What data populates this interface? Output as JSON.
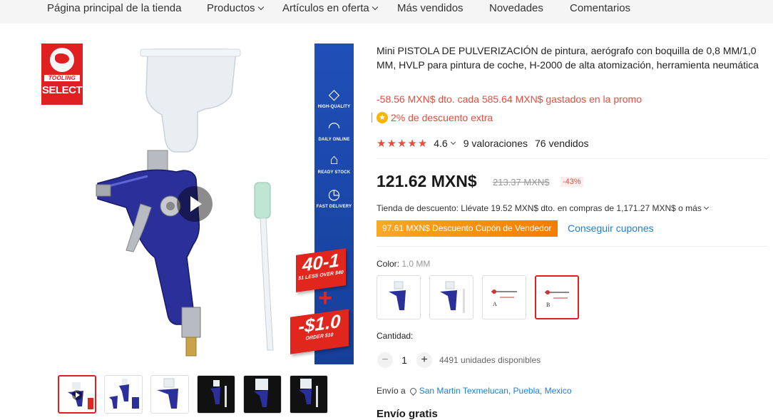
{
  "nav": {
    "items": [
      {
        "label": "Página principal de la tienda",
        "dropdown": false
      },
      {
        "label": "Productos",
        "dropdown": true
      },
      {
        "label": "Artículos en oferta",
        "dropdown": true
      },
      {
        "label": "Más vendidos",
        "dropdown": false
      },
      {
        "label": "Novedades",
        "dropdown": false
      },
      {
        "label": "Comentarios",
        "dropdown": false
      }
    ]
  },
  "gallery": {
    "brand_badge": {
      "line1": "TOOLING",
      "line2": "SELECT"
    },
    "features": [
      {
        "icon": "diamond-icon",
        "label": "HIGH-QUALITY"
      },
      {
        "icon": "headset-icon",
        "label": "DAILY ONLINE"
      },
      {
        "icon": "warehouse-icon",
        "label": "READY STOCK"
      },
      {
        "icon": "clock-icon",
        "label": "FAST DELIVERY"
      }
    ],
    "promo": {
      "big1": "40-1",
      "small1": "$1 LESS OVER $40",
      "plus": "+",
      "big2": "-$1.0",
      "small2": "ORDER $10"
    },
    "thumbnails": 6,
    "active_thumbnail": 0
  },
  "product": {
    "title": "Mini PISTOLA DE PULVERIZACIÓN de pintura, aerógrafo con boquilla de 0,8 MM/1,0 MM, HVLP para pintura de coche, H-2000 de alta atomización, herramienta neumática",
    "promo_text": "-58.56 MXN$ dto. cada 585.64 MXN$ gastados en la promo",
    "extra_discount": "2% de descuento extra",
    "rating": {
      "stars": "★★★★★",
      "value": "4.6",
      "reviews": "9 valoraciones",
      "sold": "76 vendidos"
    },
    "price": "121.62 MXN$",
    "old_price": "213.37 MXN$",
    "discount_pct": "-43%",
    "store_discount": "Tienda de descuento: Llévate 19.52 MXN$ dto. en compras de 1,171.27 MXN$ o más",
    "coupon": "97.61 MXN$ Descuento Cupón de Vendedor",
    "coupon_link": "Conseguir cupones",
    "color_label": "Color:",
    "color_value": "1.0 MM",
    "variants": 4,
    "active_variant": 3,
    "qty_label": "Cantidad:",
    "qty": "1",
    "qty_minus": "−",
    "qty_plus": "+",
    "available": "4491 unidades disponibles",
    "ship_label": "Envío a",
    "ship_location": "San Martin Texmelucan, Puebla, Mexico",
    "free_shipping": "Envío gratis"
  },
  "colors": {
    "accent": "#e84c3d",
    "link": "#1f7fd1",
    "banner": "#1f4fb8",
    "coupon": "#f5a623"
  }
}
